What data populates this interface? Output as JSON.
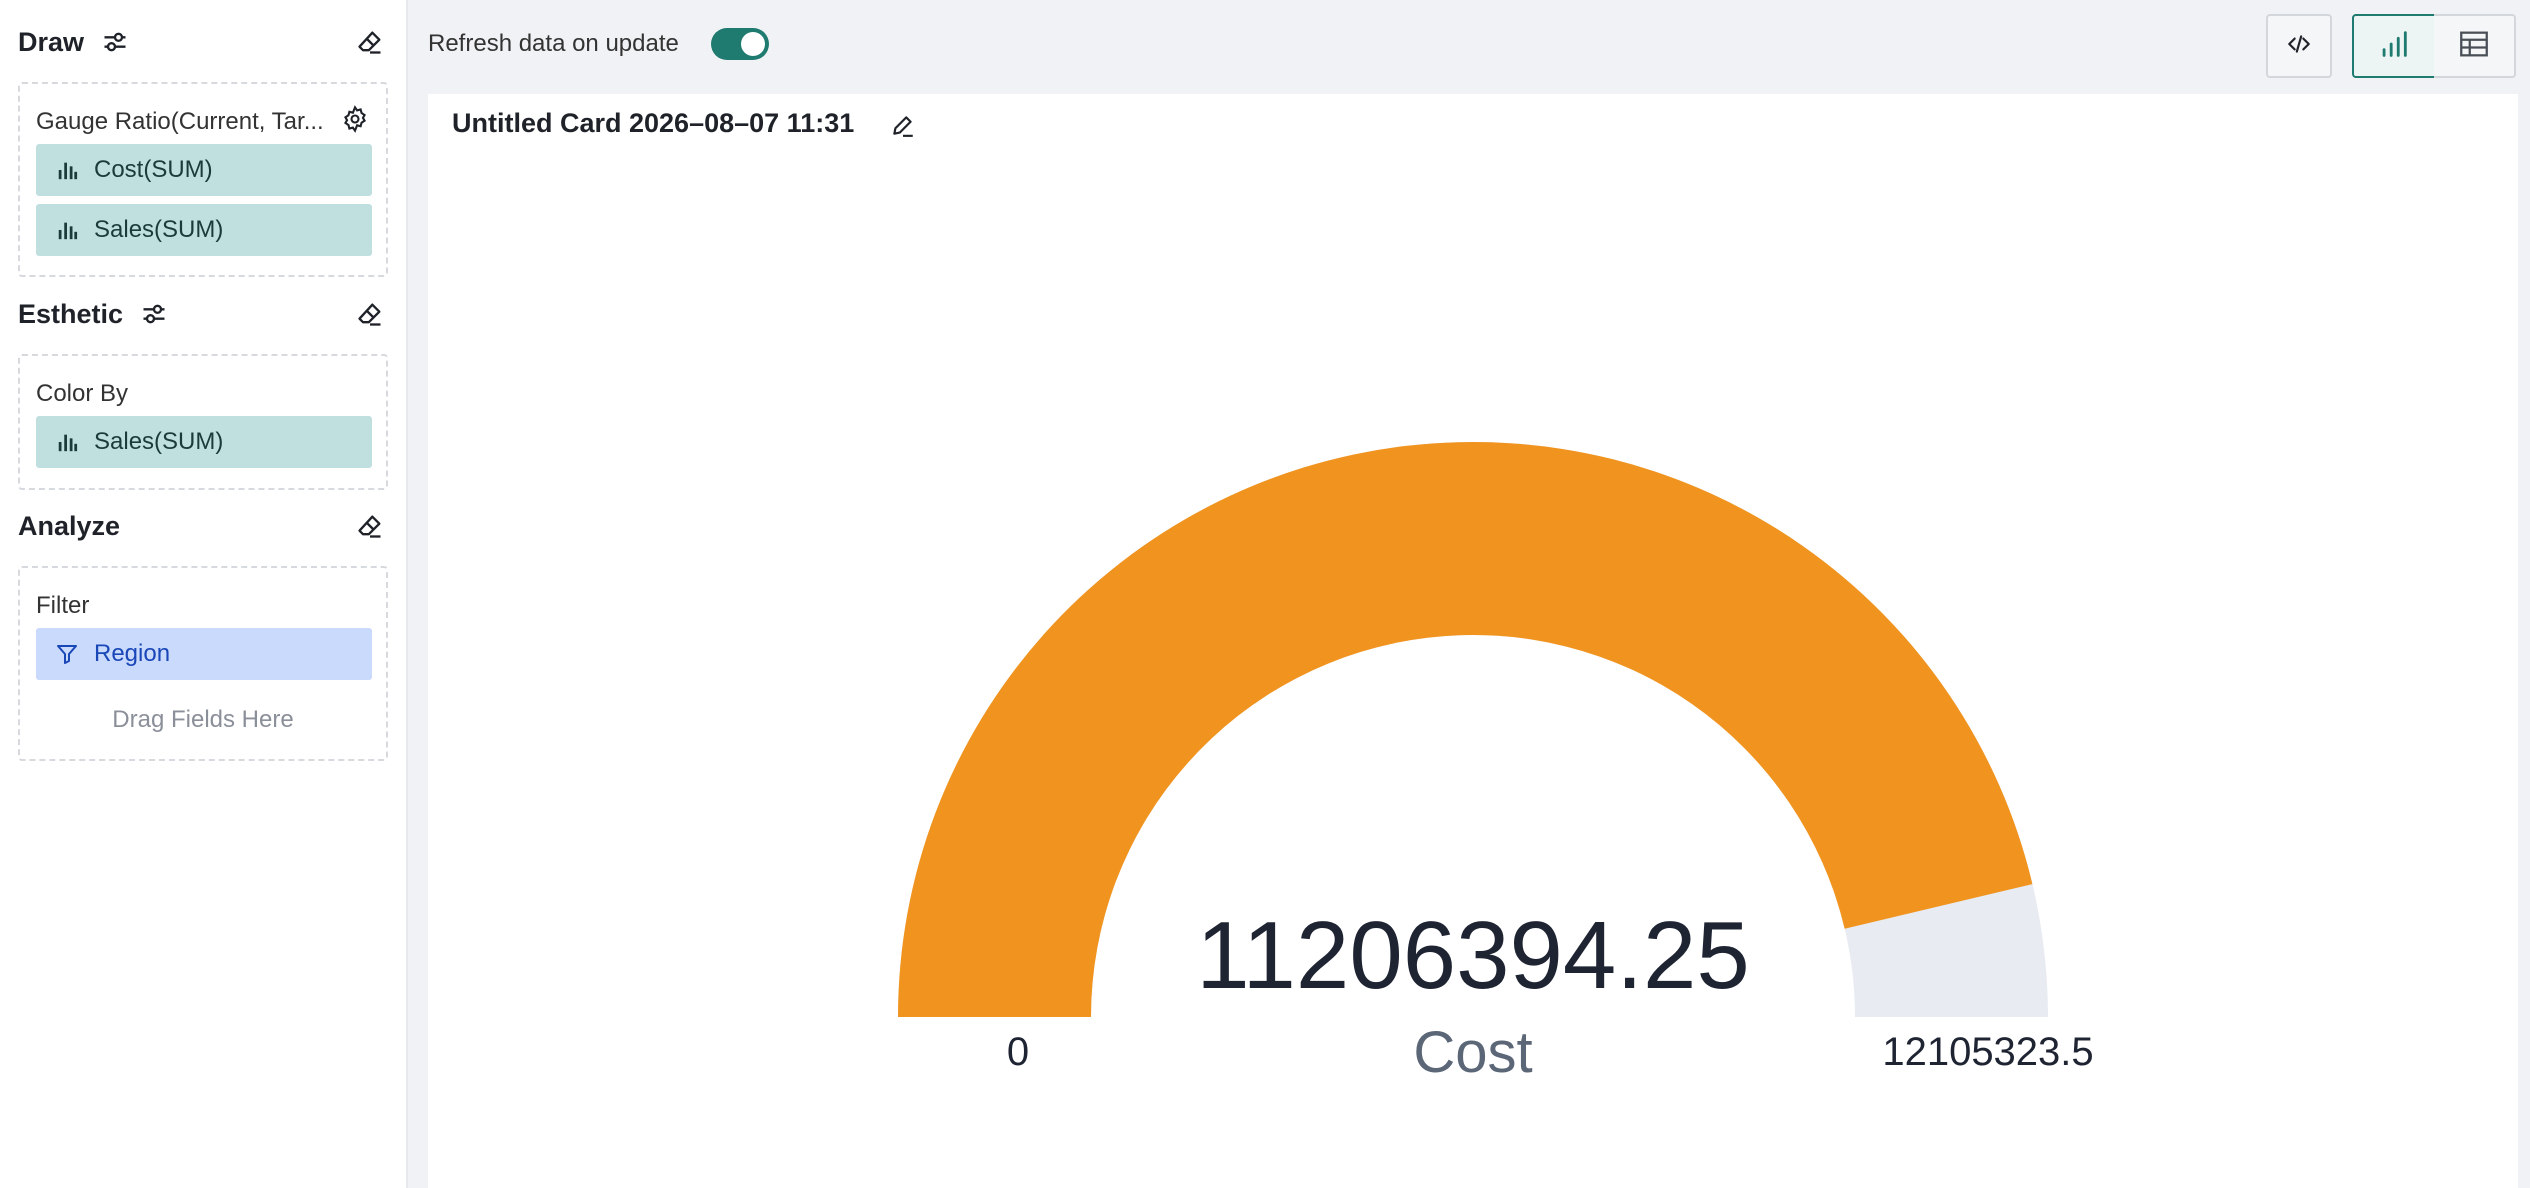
{
  "sidebar": {
    "draw": {
      "title": "Draw",
      "zone_label": "Gauge Ratio(Current, Tar...",
      "fields": [
        "Cost(SUM)",
        "Sales(SUM)"
      ]
    },
    "esthetic": {
      "title": "Esthetic",
      "zone_label": "Color By",
      "fields": [
        "Sales(SUM)"
      ]
    },
    "analyze": {
      "title": "Analyze",
      "zone_label": "Filter",
      "filter_field": "Region",
      "drag_hint": "Drag Fields Here"
    }
  },
  "topbar": {
    "refresh_label": "Refresh data on update",
    "refresh_on": true
  },
  "card": {
    "title": "Untitled Card 2026–08–07 11:31"
  },
  "chart_data": {
    "type": "gauge",
    "value": 11206394.25,
    "value_label": "11206394.25",
    "label": "Cost",
    "min": 0,
    "min_label": "0",
    "max": 12105323.5,
    "max_label": "12105323.5",
    "fill_color": "#f0941f",
    "track_color": "#e8ebf1"
  },
  "colors": {
    "accent": "#1f7a70",
    "measure_pill": "#bfe0df",
    "filter_pill": "#c9dafc"
  }
}
